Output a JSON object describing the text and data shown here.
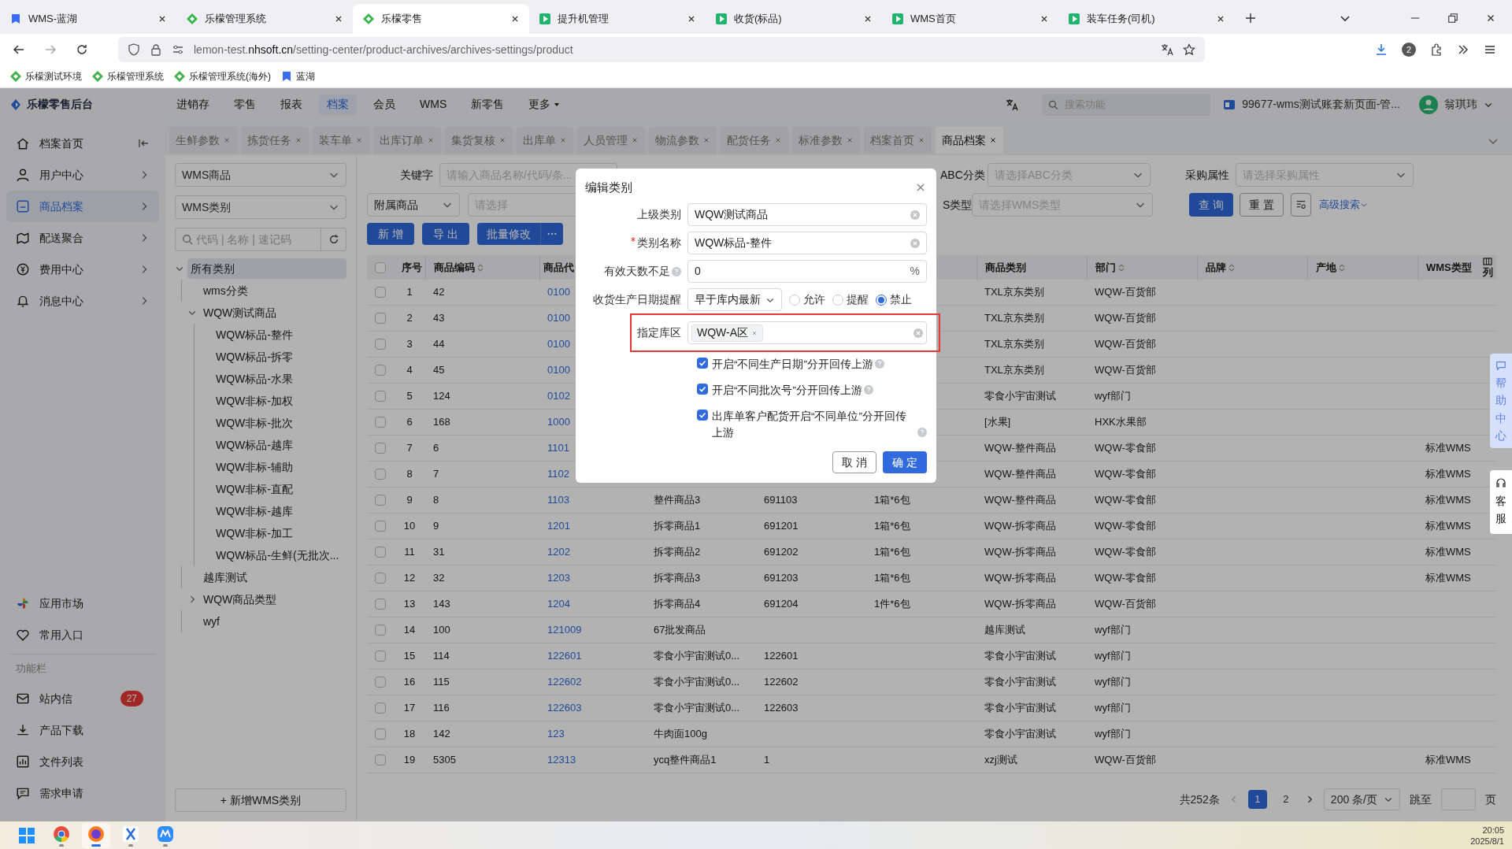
{
  "browser": {
    "tabs": [
      {
        "title": "WMS-蓝湖",
        "kind": "lanhu",
        "selected": false
      },
      {
        "title": "乐檬管理系统",
        "kind": "lemon",
        "selected": false
      },
      {
        "title": "乐檬零售",
        "kind": "lemon",
        "selected": true
      },
      {
        "title": "提升机管理",
        "kind": "app",
        "selected": false
      },
      {
        "title": "收货(标品)",
        "kind": "app",
        "selected": false
      },
      {
        "title": "WMS首页",
        "kind": "app",
        "selected": false
      },
      {
        "title": "装车任务(司机)",
        "kind": "app",
        "selected": false
      }
    ],
    "address": "lemon-test.**nhsoft.cn**/setting-center/product-archives/archives-settings/product",
    "extension_badge": "2",
    "bookmarks": [
      {
        "label": "乐檬测试环境",
        "kind": "lemon"
      },
      {
        "label": "乐檬管理系统",
        "kind": "lemon"
      },
      {
        "label": "乐檬管理系统(海外)",
        "kind": "lemon"
      },
      {
        "label": "蓝湖",
        "kind": "lanhu"
      }
    ]
  },
  "app": {
    "logo": "乐檬零售后台",
    "nav": [
      {
        "label": "进销存",
        "selected": false
      },
      {
        "label": "零售",
        "selected": false
      },
      {
        "label": "报表",
        "selected": false
      },
      {
        "label": "档案",
        "selected": true
      },
      {
        "label": "会员",
        "selected": false
      },
      {
        "label": "WMS",
        "selected": false
      },
      {
        "label": "新零售",
        "selected": false
      },
      {
        "label": "更多",
        "selected": false
      }
    ],
    "search_placeholder": "搜索功能",
    "account": "99677-wms测试账套新页面-管...",
    "user": "翁琪玮"
  },
  "sidebar": {
    "items": [
      {
        "label": "档案首页",
        "selected": false
      },
      {
        "label": "用户中心",
        "selected": false
      },
      {
        "label": "商品档案",
        "selected": true
      },
      {
        "label": "配送聚合",
        "selected": false
      },
      {
        "label": "费用中心",
        "selected": false
      },
      {
        "label": "消息中心",
        "selected": false
      }
    ],
    "shortcuts": [
      {
        "label": "应用市场"
      },
      {
        "label": "常用入口"
      }
    ],
    "section_label": "功能栏",
    "tools": [
      {
        "label": "站内信",
        "badge": "27"
      },
      {
        "label": "产品下载"
      },
      {
        "label": "文件列表"
      },
      {
        "label": "需求申请"
      }
    ]
  },
  "page_tabs": [
    {
      "label": "生鲜参数",
      "selected": false
    },
    {
      "label": "拣货任务",
      "selected": false
    },
    {
      "label": "装车单",
      "selected": false
    },
    {
      "label": "出库订单",
      "selected": false
    },
    {
      "label": "集货复核",
      "selected": false
    },
    {
      "label": "出库单",
      "selected": false
    },
    {
      "label": "人员管理",
      "selected": false
    },
    {
      "label": "物流参数",
      "selected": false
    },
    {
      "label": "配货任务",
      "selected": false
    },
    {
      "label": "标准参数",
      "selected": false
    },
    {
      "label": "档案首页",
      "selected": false
    },
    {
      "label": "商品档案",
      "selected": true
    }
  ],
  "tree_panel": {
    "selects": [
      "WMS商品",
      "WMS类别"
    ],
    "search_placeholder": "代码 | 名称 | 速记码",
    "tree": [
      {
        "label": "所有类别",
        "selected": true,
        "expanded": true,
        "children": [
          {
            "label": "wms分类",
            "selected": false
          },
          {
            "label": "WQW测试商品",
            "selected": false,
            "expanded": true,
            "children": [
              {
                "label": "WQW标品-整件",
                "selected": false
              },
              {
                "label": "WQW标品-拆零",
                "selected": false
              },
              {
                "label": "WQW标品-水果",
                "selected": false
              },
              {
                "label": "WQW非标-加权",
                "selected": false
              },
              {
                "label": "WQW非标-批次",
                "selected": false
              },
              {
                "label": "WQW标品-越库",
                "selected": false
              },
              {
                "label": "WQW非标-辅助",
                "selected": false
              },
              {
                "label": "WQW非标-直配",
                "selected": false
              },
              {
                "label": "WQW非标-越库",
                "selected": false
              },
              {
                "label": "WQW非标-加工",
                "selected": false
              },
              {
                "label": "WQW标品-生鲜(无批次...",
                "selected": false
              }
            ]
          },
          {
            "label": "越库测试",
            "selected": false
          },
          {
            "label": "WQW商品类型",
            "selected": false,
            "expanded": false
          },
          {
            "label": "wyf",
            "selected": false
          }
        ]
      }
    ],
    "add_button": "+ 新增WMS类别"
  },
  "filters": {
    "keyword_label": "关键字",
    "keyword_placeholder": "请输入商品名称/代码/条...",
    "attached_select": "附属商品",
    "attached_placeholder": "请选择",
    "abc_label": "ABC分类",
    "abc_placeholder": "请选择ABC分类",
    "purchase_label": "采购属性",
    "purchase_placeholder": "请选择采购属性",
    "wms_label": "S类型",
    "wms_placeholder": "请选择WMS类型",
    "query": "查 询",
    "reset": "重 置",
    "advanced": "高级搜索"
  },
  "actions": [
    "新 增",
    "导 出",
    "批量修改"
  ],
  "table": {
    "header_checked": false,
    "columns": [
      {
        "label": "序号",
        "sortable": false
      },
      {
        "label": "商品编码",
        "sortable": true
      },
      {
        "label": "商品代",
        "sortable": false
      },
      null,
      null,
      null,
      {
        "label": "商品类别",
        "sortable": false
      },
      {
        "label": "部门",
        "sortable": true
      },
      {
        "label": "品牌",
        "sortable": true
      },
      {
        "label": "产地",
        "sortable": true
      },
      {
        "label": "WMS类型",
        "sortable": false
      }
    ],
    "column_settings": "列",
    "rows": [
      {
        "checked": false,
        "cells": [
          "1",
          "42",
          "0100",
          null,
          null,
          null,
          "TXL京东类别",
          "WQW-百货部",
          null,
          null,
          null
        ]
      },
      {
        "checked": false,
        "cells": [
          "2",
          "43",
          "0100",
          null,
          null,
          null,
          "TXL京东类别",
          "WQW-百货部",
          null,
          null,
          null
        ]
      },
      {
        "checked": false,
        "cells": [
          "3",
          "44",
          "0100",
          null,
          null,
          null,
          "TXL京东类别",
          "WQW-百货部",
          null,
          null,
          null
        ]
      },
      {
        "checked": false,
        "cells": [
          "4",
          "45",
          "0100",
          null,
          null,
          null,
          "TXL京东类别",
          "WQW-百货部",
          null,
          null,
          null
        ]
      },
      {
        "checked": false,
        "cells": [
          "5",
          "124",
          "0102",
          null,
          null,
          null,
          "零食小宇宙测试",
          "wyf部门",
          null,
          null,
          null
        ]
      },
      {
        "checked": false,
        "cells": [
          "6",
          "168",
          "1000",
          null,
          null,
          null,
          "[水果]",
          "HXK水果部",
          null,
          null,
          null
        ]
      },
      {
        "checked": false,
        "cells": [
          "7",
          "6",
          "1101",
          null,
          null,
          null,
          "WQW-整件商品",
          "WQW-零食部",
          null,
          null,
          "标准WMS"
        ]
      },
      {
        "checked": false,
        "cells": [
          "8",
          "7",
          "1102",
          null,
          null,
          null,
          "WQW-整件商品",
          "WQW-零食部",
          null,
          null,
          "标准WMS"
        ]
      },
      {
        "checked": false,
        "cells": [
          "9",
          "8",
          "1103",
          "整件商品3",
          "691103",
          "1箱*6包",
          "WQW-整件商品",
          "WQW-零食部",
          null,
          null,
          "标准WMS"
        ]
      },
      {
        "checked": false,
        "cells": [
          "10",
          "9",
          "1201",
          "拆零商品1",
          "691201",
          "1箱*6包",
          "WQW-拆零商品",
          "WQW-零食部",
          null,
          null,
          "标准WMS"
        ]
      },
      {
        "checked": false,
        "cells": [
          "11",
          "31",
          "1202",
          "拆零商品2",
          "691202",
          "1箱*6包",
          "WQW-拆零商品",
          "WQW-零食部",
          null,
          null,
          "标准WMS"
        ]
      },
      {
        "checked": false,
        "cells": [
          "12",
          "32",
          "1203",
          "拆零商品3",
          "691203",
          "1箱*6包",
          "WQW-拆零商品",
          "WQW-零食部",
          null,
          null,
          "标准WMS"
        ]
      },
      {
        "checked": false,
        "cells": [
          "13",
          "143",
          "1204",
          "拆零商品4",
          "691204",
          "1件*6包",
          "WQW-拆零商品",
          "WQW-百货部",
          null,
          null,
          null
        ]
      },
      {
        "checked": false,
        "cells": [
          "14",
          "100",
          "121009",
          "67批发商品",
          null,
          null,
          "越库测试",
          "wyf部门",
          null,
          null,
          null
        ]
      },
      {
        "checked": false,
        "cells": [
          "15",
          "114",
          "122601",
          "零食小宇宙测试0...",
          "122601",
          null,
          "零食小宇宙测试",
          "wyf部门",
          null,
          null,
          null
        ]
      },
      {
        "checked": false,
        "cells": [
          "16",
          "115",
          "122602",
          "零食小宇宙测试0...",
          "122602",
          null,
          "零食小宇宙测试",
          "wyf部门",
          null,
          null,
          null
        ]
      },
      {
        "checked": false,
        "cells": [
          "17",
          "116",
          "122603",
          "零食小宇宙测试0...",
          "122603",
          null,
          "零食小宇宙测试",
          "wyf部门",
          null,
          null,
          null
        ]
      },
      {
        "checked": false,
        "cells": [
          "18",
          "142",
          "123",
          "牛肉面100g",
          null,
          null,
          "零食小宇宙测试",
          "wyf部门",
          null,
          null,
          null
        ]
      },
      {
        "checked": false,
        "cells": [
          "19",
          "5305",
          "12313",
          "ycq整件商品1",
          "1",
          null,
          "xzj测试",
          "WQW-百货部",
          null,
          null,
          "标准WMS"
        ]
      }
    ]
  },
  "pagination": {
    "total": "共252条",
    "pages": [
      {
        "label": "1",
        "selected": true
      },
      {
        "label": "2",
        "selected": false
      }
    ],
    "page_size": "200 条/页",
    "jump_label": "跳至",
    "page_suffix": "页"
  },
  "modal": {
    "title": "编辑类别",
    "fields": [
      {
        "kind": "text",
        "label": "上级类别",
        "required": false,
        "value": "WQW测试商品"
      },
      {
        "kind": "text",
        "label": "类别名称",
        "required": true,
        "value": "WQW标品-整件"
      },
      {
        "kind": "number",
        "label": "有效天数不足",
        "value": "0",
        "suffix": "%"
      },
      {
        "kind": "reminder",
        "label": "收货生产日期提醒",
        "select": "早于库内最新",
        "options": [
          {
            "label": "允许",
            "selected": false
          },
          {
            "label": "提醒",
            "selected": false
          },
          {
            "label": "禁止",
            "selected": true
          }
        ]
      },
      {
        "kind": "tags",
        "label": "指定库区",
        "highlighted": true,
        "tags": [
          "WQW-A区"
        ]
      }
    ],
    "checks": [
      {
        "label": "开启“不同生产日期”分开回传上游",
        "checked": true
      },
      {
        "label": "开启“不同批次号”分开回传上游",
        "checked": true
      },
      {
        "label": "出库单客户配货开启“不同单位”分开回传上游",
        "checked": true
      }
    ],
    "cancel": "取 消",
    "ok": "确 定"
  },
  "help": {
    "help_center": "帮助中心",
    "service": "客服"
  },
  "taskbar": {
    "apps": [
      {
        "selected": false
      },
      {
        "selected": false
      },
      {
        "selected": true
      },
      {
        "selected": false
      },
      {
        "selected": false
      }
    ],
    "time": "20:05",
    "date": "2025/8/1"
  }
}
